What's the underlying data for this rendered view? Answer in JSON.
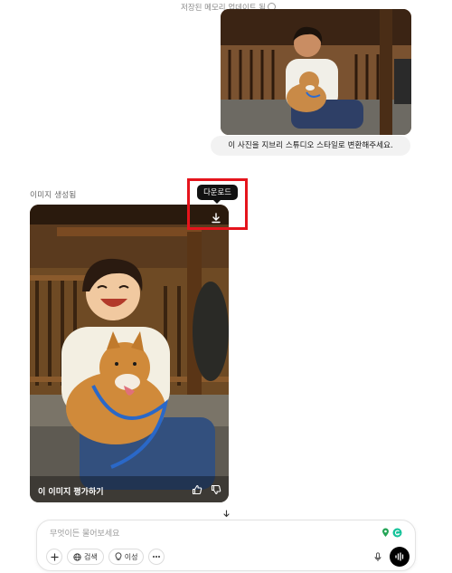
{
  "header": {
    "memory_note": "저장된 메모리 업데이트 됨"
  },
  "user_message": {
    "photo": "user-uploaded-photo",
    "text": "이 사진을 지브리 스튜디오 스타일로 변환해주세요."
  },
  "assistant": {
    "status_label": "이미지 생성됨",
    "image": "generated-ghibli-style-image",
    "download_tooltip": "다운로드",
    "rate_label": "이 이미지 평가하기"
  },
  "composer": {
    "placeholder": "무엇이든 물어보세요",
    "search_label": "검색",
    "reason_label": "이성"
  },
  "colors": {
    "highlight": "#e5141c",
    "tooltip_bg": "#111111",
    "bubble_bg": "#f2f2f2",
    "voice_button": "#000000"
  },
  "icons": [
    "info-icon",
    "download-icon",
    "thumbs-up-icon",
    "thumbs-down-icon",
    "arrow-down-icon",
    "plus-icon",
    "globe-icon",
    "lightbulb-icon",
    "more-icon",
    "mic-icon",
    "voice-mode-icon",
    "extension-icon"
  ]
}
